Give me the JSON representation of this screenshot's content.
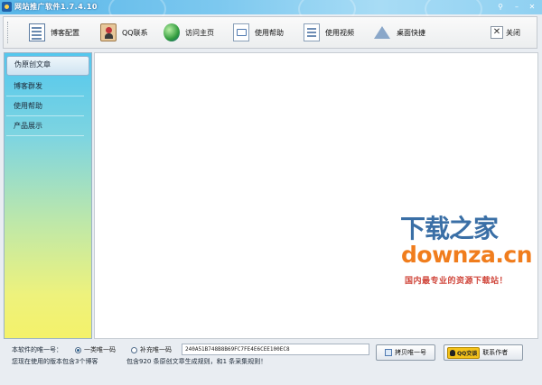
{
  "window": {
    "title": "网站推广软件1.7.4.10"
  },
  "toolbar": {
    "items": [
      {
        "label": "博客配置",
        "icon": "config-document-icon"
      },
      {
        "label": "QQ联系",
        "icon": "qq-contact-icon"
      },
      {
        "label": "访问主页",
        "icon": "globe-icon"
      },
      {
        "label": "使用帮助",
        "icon": "help-window-icon"
      },
      {
        "label": "使用视频",
        "icon": "video-document-icon"
      },
      {
        "label": "桌面快捷",
        "icon": "desktop-shortcut-icon"
      },
      {
        "label": "关闭",
        "icon": "close-icon"
      }
    ]
  },
  "sidebar": {
    "items": [
      {
        "label": "伪原创文章",
        "active": true
      },
      {
        "label": "博客群发",
        "active": false
      },
      {
        "label": "使用帮助",
        "active": false
      },
      {
        "label": "产品展示",
        "active": false
      }
    ]
  },
  "watermark": {
    "title": "下载之家",
    "url": "downza.cn",
    "tagline": "国内最专业的资源下载站！"
  },
  "status": {
    "unique_code_label": "本软件的唯一号：",
    "radio_primary": "一类唯一码",
    "radio_secondary": "补充唯一码",
    "unique_code_value": "240A51B748B8B69FC7FE4E6CEE100EC8",
    "version_info": "您现在使用的版本包含3个博客",
    "rules_info": "包含920 条原创文章生成规则，和1 条采集规则！",
    "copy_button": "拷贝唯一号",
    "qq_badge": "QQ交谈",
    "contact_author": "联系作者"
  },
  "colors": {
    "titlebar": "#7cc8ef",
    "watermark_blue": "#3a6fa6",
    "watermark_orange": "#f07d1d",
    "watermark_red": "#d0463b"
  }
}
